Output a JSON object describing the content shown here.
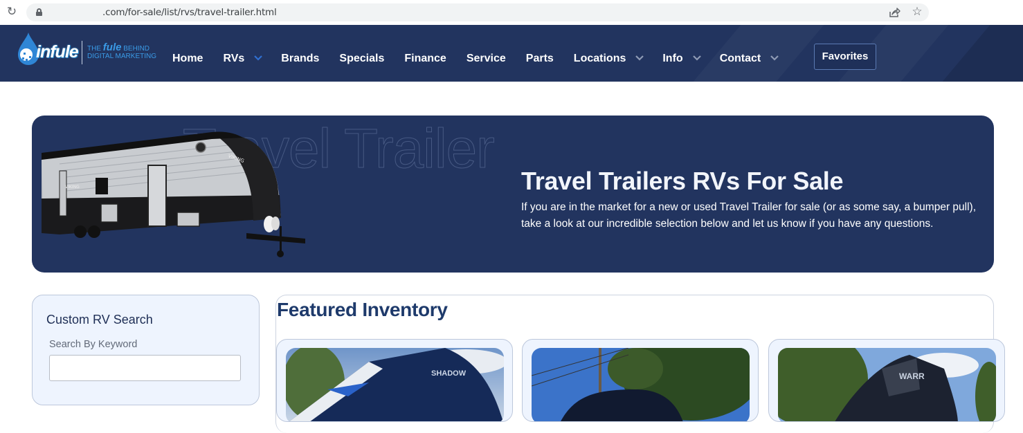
{
  "browser": {
    "url": ".com/for-sale/list/rvs/travel-trailer.html",
    "reload_icon": "reload-icon",
    "lock_icon": "lock-icon",
    "share_icon": "share-icon",
    "bookmark_icon": "star-icon"
  },
  "header": {
    "logo": {
      "name": "infule",
      "tagline_prefix": "THE",
      "tagline_brand": "fule",
      "tagline_suffix": "BEHIND",
      "tagline_line2": "DIGITAL MARKETING"
    },
    "nav": [
      {
        "label": "Home",
        "has_dropdown": false
      },
      {
        "label": "RVs",
        "has_dropdown": true
      },
      {
        "label": "Brands",
        "has_dropdown": false
      },
      {
        "label": "Specials",
        "has_dropdown": false
      },
      {
        "label": "Finance",
        "has_dropdown": false
      },
      {
        "label": "Service",
        "has_dropdown": false
      },
      {
        "label": "Parts",
        "has_dropdown": false
      },
      {
        "label": "Locations",
        "has_dropdown": true
      },
      {
        "label": "Info",
        "has_dropdown": true
      },
      {
        "label": "Contact",
        "has_dropdown": true
      }
    ],
    "favorites_label": "Favorites",
    "colors": {
      "background": "#22345f",
      "rvs_chevron": "#2f6fd1",
      "chevron": "#8f9bb5"
    }
  },
  "hero": {
    "ghost_text": "Travel Trailer",
    "title": "Travel Trailers RVs For Sale",
    "description": "If you are in the market for a new or used Travel Trailer for sale (or as some say, a bumper pull), take a look at our incredible selection below and let us know if you have any questions.",
    "image": "travel-trailer-image"
  },
  "search": {
    "title": "Custom RV Search",
    "keyword_label": "Search By Keyword",
    "keyword_value": "",
    "keyword_placeholder": ""
  },
  "featured": {
    "title": "Featured Inventory",
    "cards": [
      {
        "image": "rv-photo-1"
      },
      {
        "image": "rv-photo-2"
      },
      {
        "image": "rv-photo-3"
      }
    ]
  }
}
